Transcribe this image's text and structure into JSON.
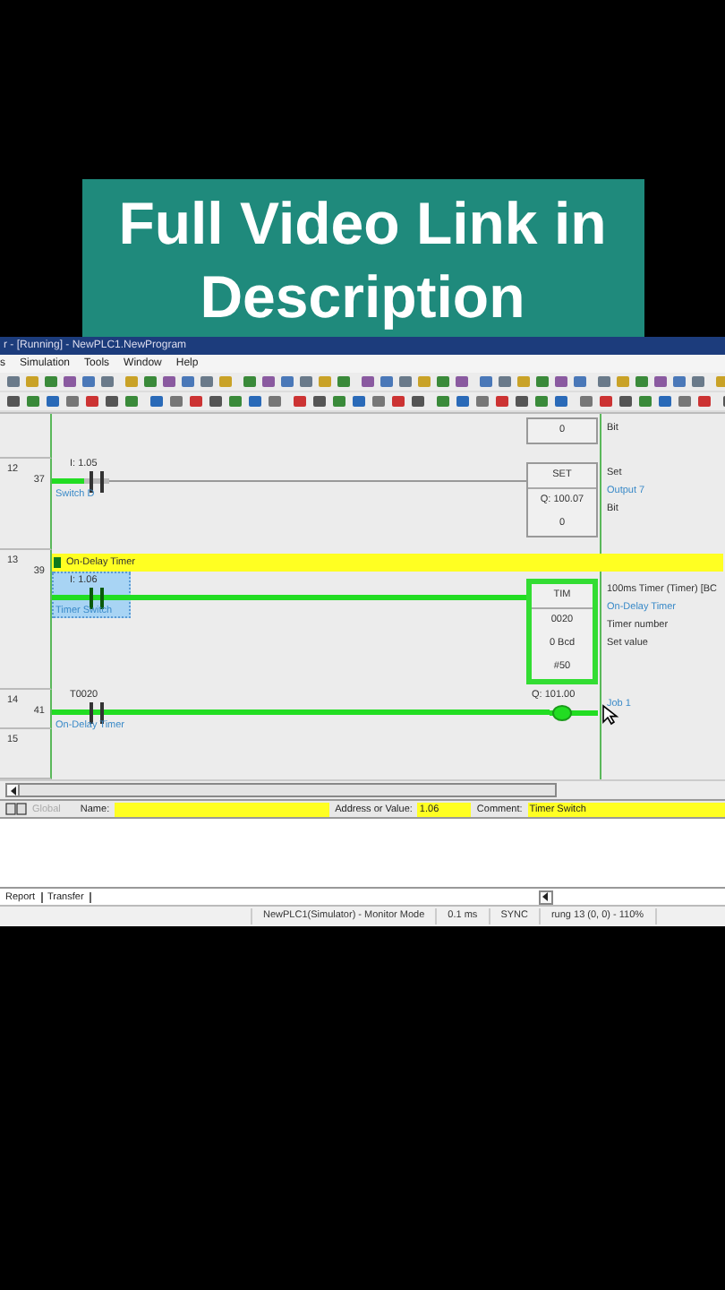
{
  "caption": {
    "lines": [
      "Full Video Link in",
      "Description"
    ]
  },
  "window": {
    "title": "r - [Running] - NewPLC1.NewProgram"
  },
  "menu": [
    {
      "label": "s"
    },
    {
      "label": "Simulation"
    },
    {
      "label": "Tools"
    },
    {
      "label": "Window"
    },
    {
      "label": "Help"
    }
  ],
  "ladder": {
    "rungs": [
      {
        "elements": [
          {
            "kind": "box",
            "lines": [
              "0"
            ],
            "highlighted": false
          }
        ],
        "notes": [
          {
            "text": "Bit",
            "kind": "text"
          }
        ]
      },
      {
        "number": "12",
        "step": "37",
        "elements": [
          {
            "kind": "contact",
            "address": "I: 1.05",
            "label": "Switch D",
            "powered": false,
            "selected": false
          },
          {
            "kind": "box",
            "lines": [
              "SET",
              "Q: 100.07",
              "0"
            ],
            "highlighted": false
          }
        ],
        "notes": [
          {
            "text": "Set",
            "kind": "text"
          },
          {
            "text": "Output 7",
            "kind": "comment"
          },
          {
            "text": "Bit",
            "kind": "text"
          }
        ]
      },
      {
        "number": "13",
        "step": "39",
        "comment": "On-Delay Timer",
        "elements": [
          {
            "kind": "contact",
            "address": "I: 1.06",
            "label": "Timer Switch",
            "powered": true,
            "selected": true
          },
          {
            "kind": "box",
            "lines": [
              "TIM",
              "0020",
              "0 Bcd",
              "#50"
            ],
            "highlighted": true
          }
        ],
        "notes": [
          {
            "text": "100ms Timer (Timer) [BC",
            "kind": "text"
          },
          {
            "text": "On-Delay Timer",
            "kind": "comment"
          },
          {
            "text": "Timer number",
            "kind": "text"
          },
          {
            "text": "Set value",
            "kind": "text"
          }
        ]
      },
      {
        "number": "14",
        "step": "41",
        "elements": [
          {
            "kind": "contact",
            "address": "T0020",
            "label": "On-Delay Timer",
            "powered": true,
            "selected": false
          },
          {
            "kind": "coil",
            "address": "Q: 101.00",
            "powered": true
          }
        ],
        "notes": [
          {
            "text": "Job 1",
            "kind": "comment"
          }
        ]
      },
      {
        "number": "15"
      }
    ]
  },
  "property_bar": {
    "scope": {
      "label": "Global",
      "disabled": true
    },
    "name_label": "Name:",
    "address_label": "Address or Value:",
    "address_value": "1.06",
    "comment_label": "Comment:",
    "comment_value": "Timer Switch"
  },
  "output_tabs": [
    {
      "label": "Report"
    },
    {
      "label": "Transfer"
    }
  ],
  "status_bar": [
    "NewPLC1(Simulator) - Monitor Mode",
    "0.1 ms",
    "SYNC",
    "rung 13 (0, 0) - 110%"
  ]
}
